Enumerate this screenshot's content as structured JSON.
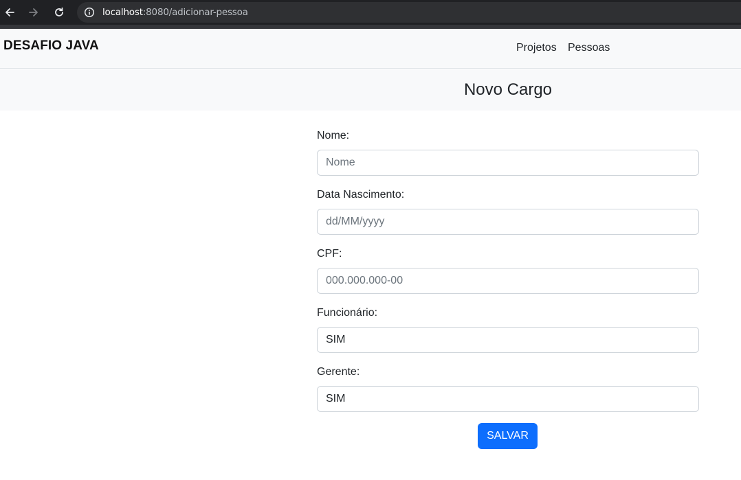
{
  "browser": {
    "url_host": "localhost",
    "url_rest": ":8080/adicionar-pessoa"
  },
  "navbar": {
    "brand": "DESAFIO JAVA",
    "links": [
      {
        "label": "Projetos"
      },
      {
        "label": "Pessoas"
      }
    ]
  },
  "page": {
    "title": "Novo Cargo"
  },
  "form": {
    "nome": {
      "label": "Nome:",
      "placeholder": "Nome",
      "value": ""
    },
    "data_nascimento": {
      "label": "Data Nascimento:",
      "placeholder": "dd/MM/yyyy",
      "value": ""
    },
    "cpf": {
      "label": "CPF:",
      "placeholder": "000.000.000-00",
      "value": ""
    },
    "funcionario": {
      "label": "Funcionário:",
      "selected": "SIM"
    },
    "gerente": {
      "label": "Gerente:",
      "selected": "SIM"
    },
    "submit_label": "SALVAR"
  },
  "colors": {
    "primary": "#0d6efd",
    "navbar_bg": "#f8f9fa",
    "chrome_bg": "#202124"
  },
  "icons": [
    "back-arrow-icon",
    "forward-arrow-icon",
    "reload-icon",
    "info-icon"
  ]
}
